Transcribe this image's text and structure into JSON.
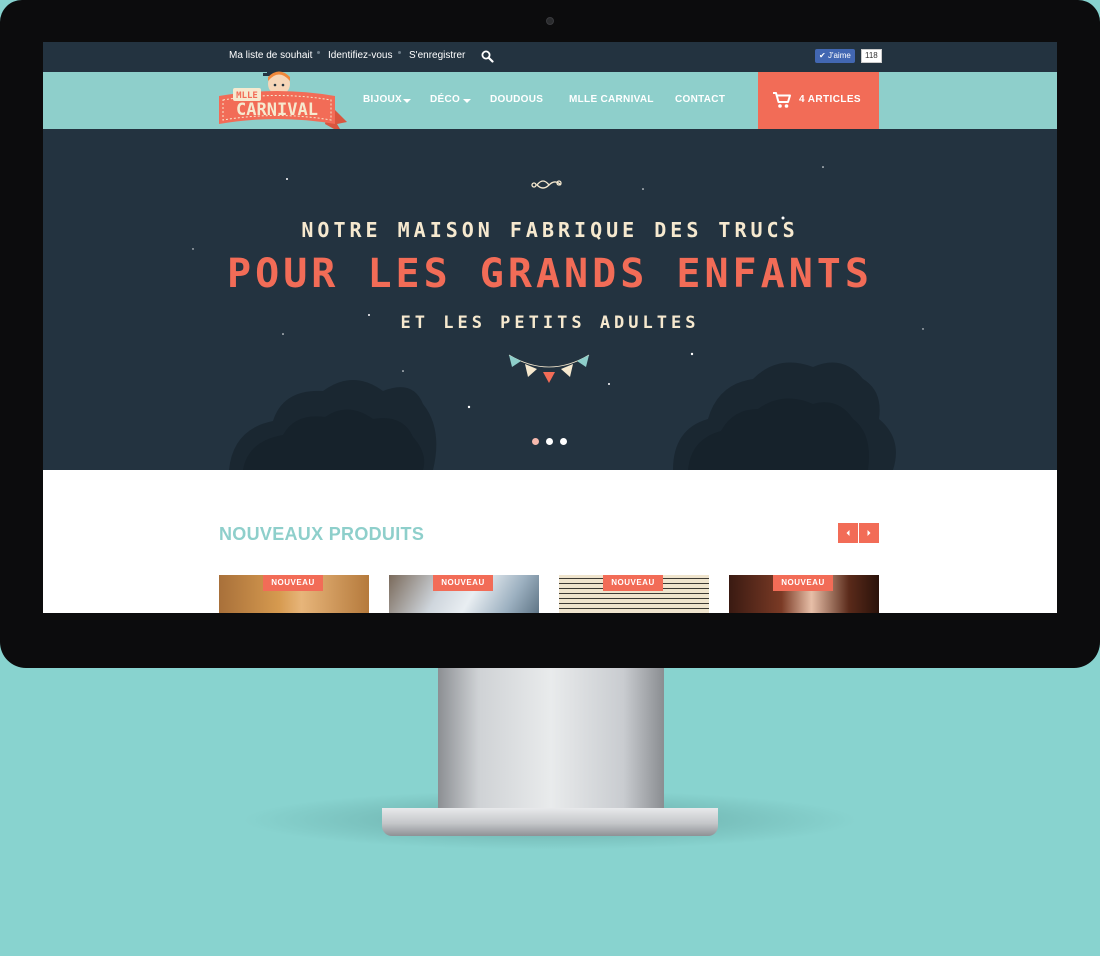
{
  "colors": {
    "background": "#88d3cf",
    "accent": "#f26c57",
    "nav": "#8ecfcb",
    "dark": "#233340",
    "cream": "#f6e9cf"
  },
  "topbar": {
    "wishlist": "Ma liste de souhait",
    "login": "Identifiez-vous",
    "register": "S'enregistrer",
    "search_icon": "search-icon",
    "fb_like": "J'aime",
    "fb_count": "118"
  },
  "logo": {
    "line1": "MLLE",
    "line2": "CARNIVAL"
  },
  "nav": {
    "items": [
      "BIJOUX",
      "DÉCO",
      "DOUDOUS",
      "MLLE CARNIVAL",
      "CONTACT"
    ],
    "cart": "4 ARTICLES"
  },
  "hero": {
    "line1": "NOTRE MAISON FABRIQUE DES TRUCS",
    "line2": "POUR LES GRANDS ENFANTS",
    "line3": "ET LES PETITS ADULTES",
    "slide_count": 3,
    "active_slide": 1
  },
  "products": {
    "title": "NOUVEAUX PRODUITS",
    "badges": [
      "NOUVEAU",
      "NOUVEAU",
      "NOUVEAU",
      "NOUVEAU"
    ]
  }
}
